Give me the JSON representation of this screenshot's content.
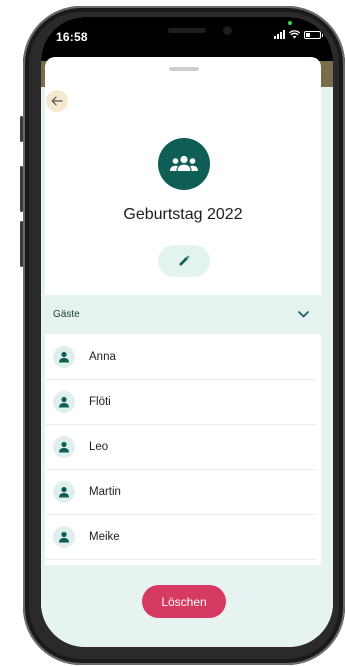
{
  "status_bar": {
    "time": "16:58"
  },
  "group": {
    "title": "Geburtstag 2022"
  },
  "guests": {
    "header": "Gäste",
    "items": [
      {
        "name": "Anna"
      },
      {
        "name": "Flöti"
      },
      {
        "name": "Leo"
      },
      {
        "name": "Martin"
      },
      {
        "name": "Meike"
      }
    ]
  },
  "actions": {
    "delete_label": "Löschen"
  },
  "colors": {
    "accent": "#0e5e55",
    "danger": "#d63a62",
    "section_bg": "#e5f2ef"
  },
  "icons": {
    "back": "arrow-left-icon",
    "group": "group-icon",
    "edit": "pencil-icon",
    "person": "person-icon",
    "expand": "chevron-down-icon"
  }
}
